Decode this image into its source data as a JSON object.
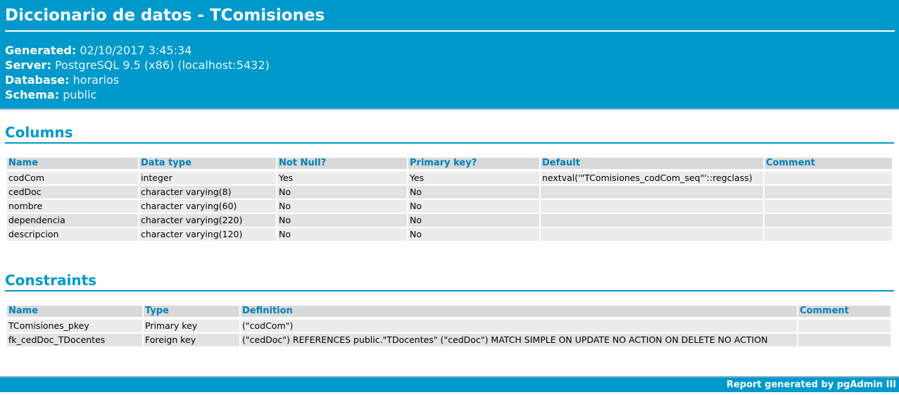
{
  "title": "Diccionario de datos - TComisiones",
  "meta": [
    {
      "key": "Generated:",
      "value": "02/10/2017 3:45:34"
    },
    {
      "key": "Server:",
      "value": "PostgreSQL 9.5 (x86) (localhost:5432)"
    },
    {
      "key": "Database:",
      "value": "horarios"
    },
    {
      "key": "Schema:",
      "value": "public"
    }
  ],
  "columns_section": {
    "title": "Columns",
    "headers": [
      "Name",
      "Data type",
      "Not Null?",
      "Primary key?",
      "Default",
      "Comment"
    ],
    "rows": [
      [
        "codCom",
        "integer",
        "Yes",
        "Yes",
        "nextval('\"TComisiones_codCom_seq\"'::regclass)",
        ""
      ],
      [
        "cedDoc",
        "character varying(8)",
        "No",
        "No",
        "",
        ""
      ],
      [
        "nombre",
        "character varying(60)",
        "No",
        "No",
        "",
        ""
      ],
      [
        "dependencia",
        "character varying(220)",
        "No",
        "No",
        "",
        ""
      ],
      [
        "descripcion",
        "character varying(120)",
        "No",
        "No",
        "",
        ""
      ]
    ]
  },
  "constraints_section": {
    "title": "Constraints",
    "headers": [
      "Name",
      "Type",
      "Definition",
      "Comment"
    ],
    "rows": [
      [
        "TComisiones_pkey",
        "Primary key",
        "(\"codCom\")",
        ""
      ],
      [
        "fk_cedDoc_TDocentes",
        "Foreign key",
        "(\"cedDoc\") REFERENCES public.\"TDocentes\" (\"cedDoc\") MATCH SIMPLE ON UPDATE NO ACTION ON DELETE NO ACTION",
        ""
      ]
    ]
  },
  "footer": "Report generated by pgAdmin III"
}
